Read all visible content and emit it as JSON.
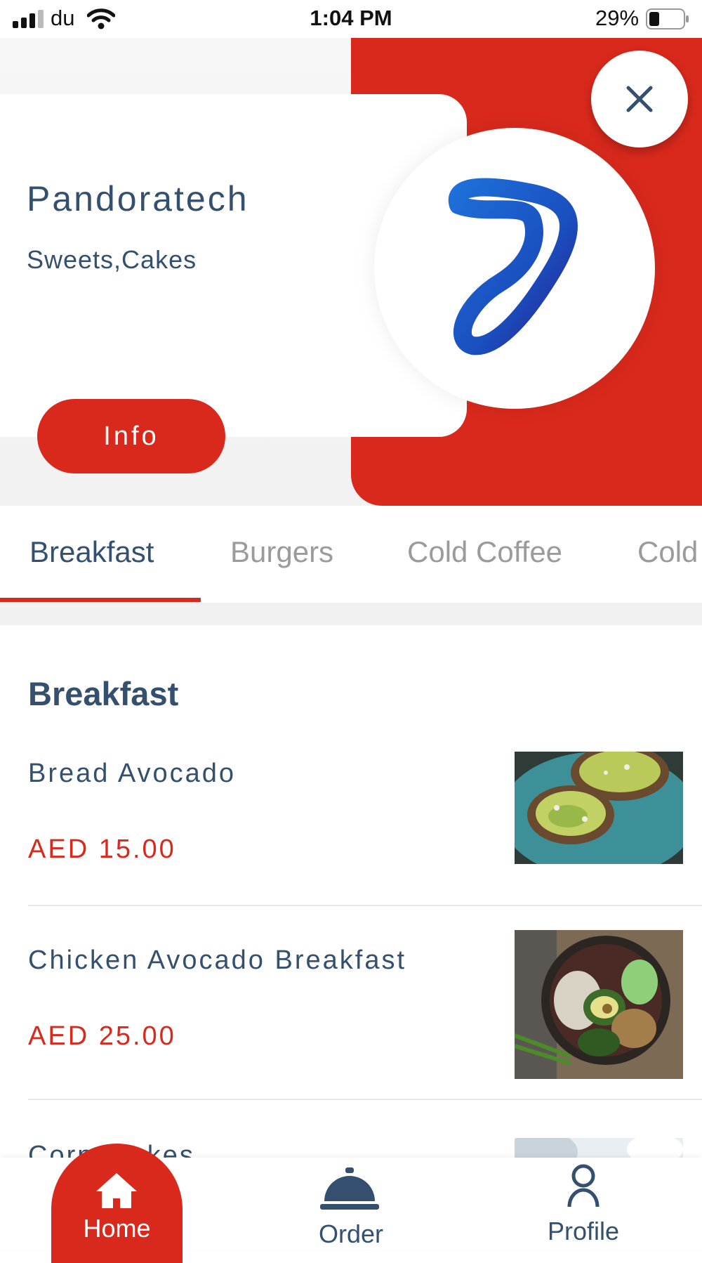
{
  "status_bar": {
    "carrier": "du",
    "time": "1:04 PM",
    "battery": "29%"
  },
  "store": {
    "name": "Pandoratech",
    "categories": "Sweets,Cakes",
    "info_label": "Info",
    "accent_color": "#d9291c",
    "text_color": "#34506e"
  },
  "tabs": [
    {
      "label": "Breakfast",
      "active": true
    },
    {
      "label": "Burgers",
      "active": false
    },
    {
      "label": "Cold Coffee",
      "active": false
    },
    {
      "label": "Cold",
      "active": false
    }
  ],
  "menu": {
    "section_title": "Breakfast",
    "items": [
      {
        "name": "Bread Avocado",
        "price": "AED 15.00"
      },
      {
        "name": "Chicken Avocado Breakfast",
        "price": "AED 25.00"
      },
      {
        "name": "Corn Flakes",
        "price": ""
      }
    ]
  },
  "bottom_nav": {
    "home_label": "Home",
    "order_label": "Order",
    "profile_label": "Profile"
  }
}
